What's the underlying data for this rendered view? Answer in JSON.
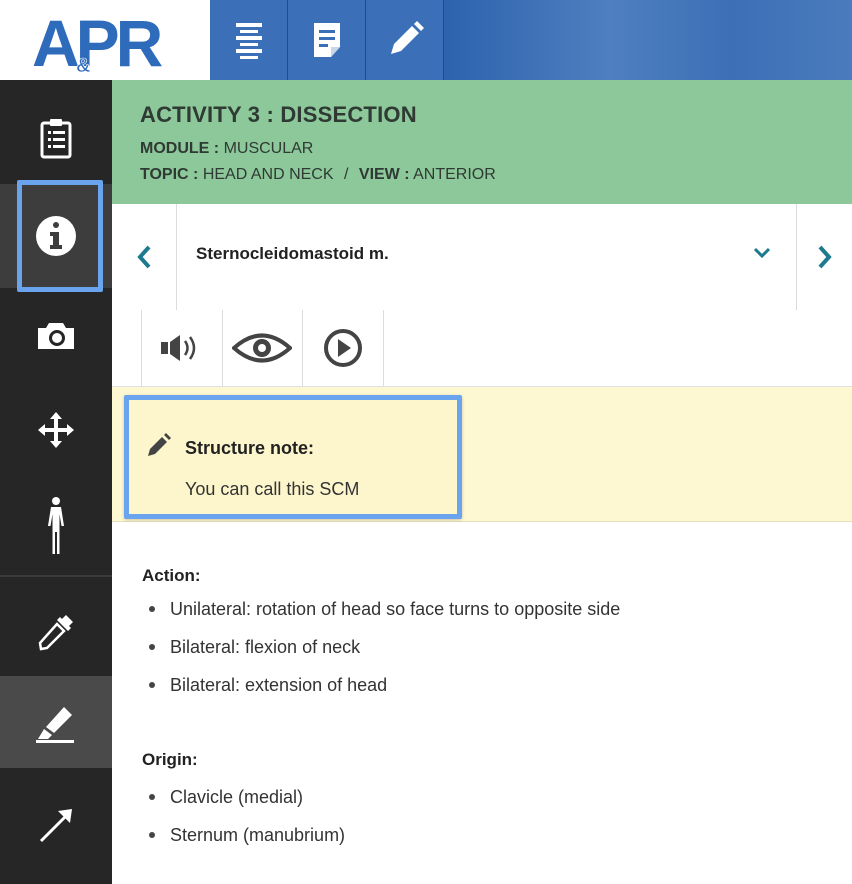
{
  "logo": {
    "text_main": "APR",
    "text_amp": "&"
  },
  "topbar": {
    "buttons": [
      "outline-icon",
      "notes-icon",
      "edit-icon"
    ]
  },
  "sidebar": {
    "items": [
      "clipboard-icon",
      "info-icon",
      "camera-icon",
      "move-icon",
      "body-icon",
      "eyedropper-icon",
      "highlighter-icon",
      "arrow-icon"
    ]
  },
  "header": {
    "title": "ACTIVITY 3 : DISSECTION",
    "module_label": "MODULE :",
    "module_value": "MUSCULAR",
    "topic_label": "TOPIC :",
    "topic_value": "HEAD AND NECK",
    "separator": "/",
    "view_label": "VIEW :",
    "view_value": "ANTERIOR"
  },
  "structure": {
    "name": "Sternocleidomastoid m."
  },
  "tools": [
    "audio-icon",
    "eye-icon",
    "play-icon"
  ],
  "note": {
    "heading": "Structure note:",
    "body": "You can call this SCM"
  },
  "content": {
    "action_title": "Action:",
    "action_items": [
      "Unilateral: rotation of head so face turns to opposite side",
      "Bilateral: flexion of neck",
      "Bilateral: extension of head"
    ],
    "origin_title": "Origin:",
    "origin_items": [
      "Clavicle (medial)",
      "Sternum (manubrium)"
    ]
  },
  "colors": {
    "topbar": "#2d64ad",
    "header": "#8dc89a",
    "sidebar": "#262626",
    "highlight": "#6aa3ee",
    "note_bg": "#fdf7d2",
    "nav_arrow": "#1d7a8f"
  }
}
